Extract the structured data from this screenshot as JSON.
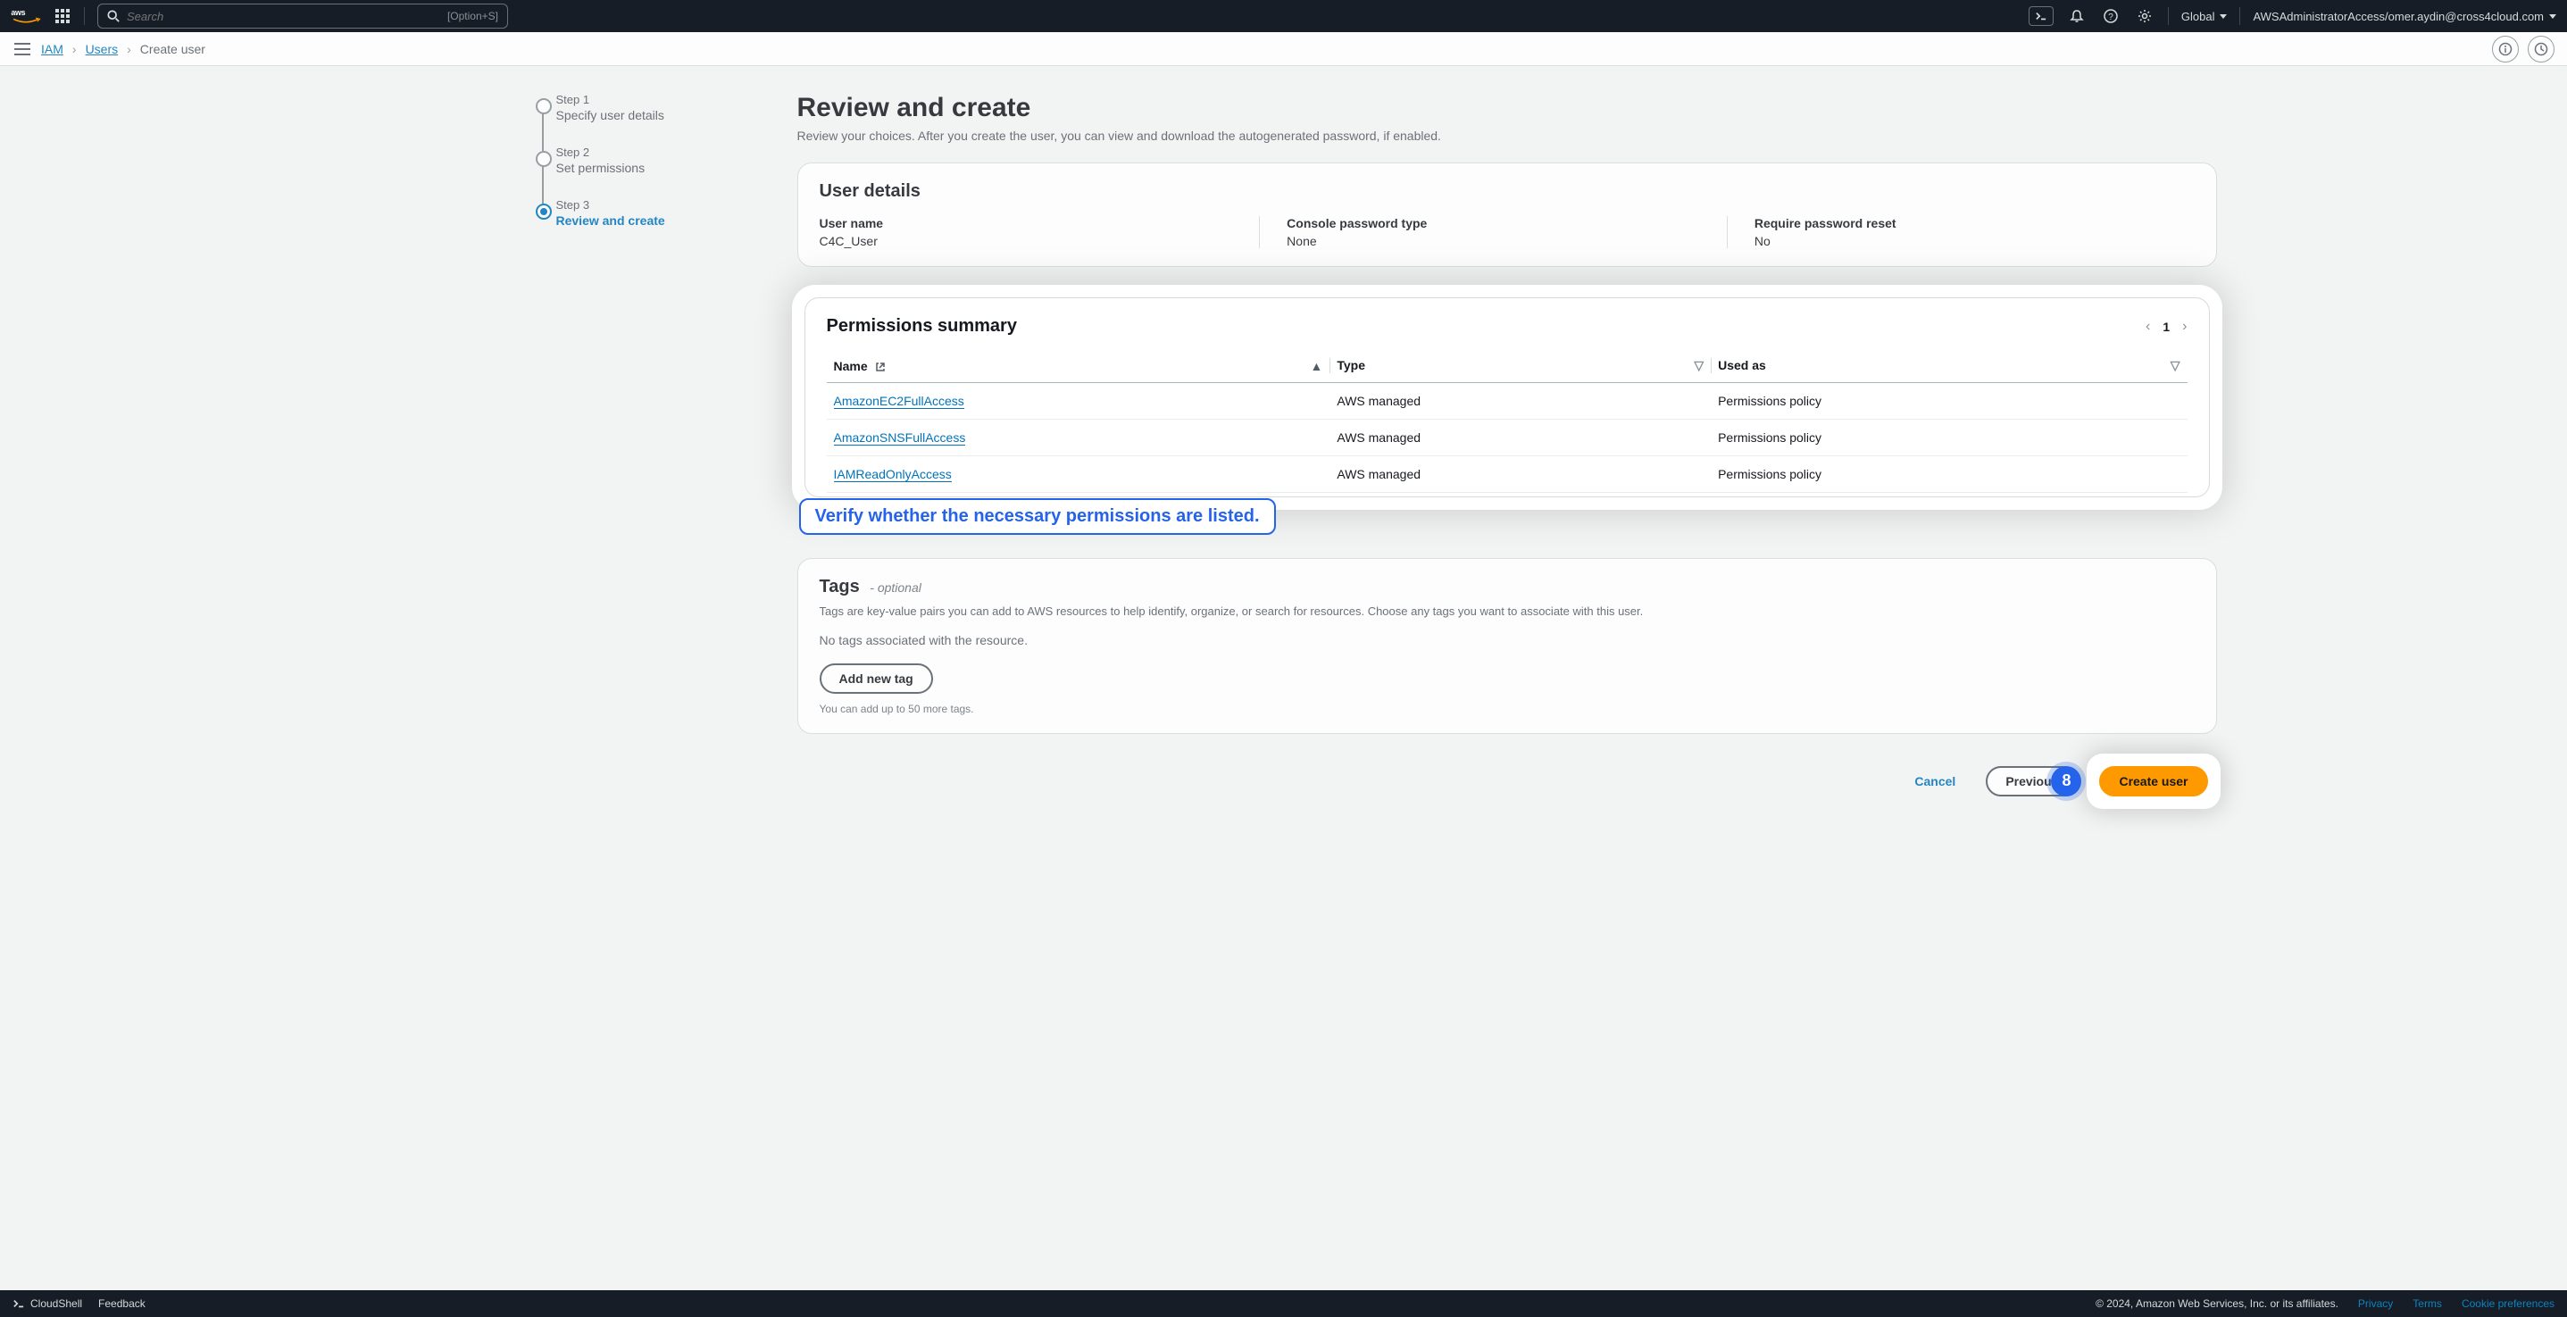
{
  "header": {
    "logo_text": "aws",
    "search_placeholder": "Search",
    "search_kbd": "[Option+S]",
    "region": "Global",
    "account": "AWSAdministratorAccess/omer.aydin@cross4cloud.com"
  },
  "breadcrumb": {
    "items": [
      "IAM",
      "Users",
      "Create user"
    ]
  },
  "steps": [
    {
      "label": "Step 1",
      "title": "Specify user details"
    },
    {
      "label": "Step 2",
      "title": "Set permissions"
    },
    {
      "label": "Step 3",
      "title": "Review and create"
    }
  ],
  "page": {
    "title": "Review and create",
    "subtitle": "Review your choices. After you create the user, you can view and download the autogenerated password, if enabled."
  },
  "user_details": {
    "heading": "User details",
    "fields": [
      {
        "k": "User name",
        "v": "C4C_User"
      },
      {
        "k": "Console password type",
        "v": "None"
      },
      {
        "k": "Require password reset",
        "v": "No"
      }
    ]
  },
  "permissions": {
    "heading": "Permissions summary",
    "columns": {
      "name": "Name",
      "type": "Type",
      "used_as": "Used as"
    },
    "rows": [
      {
        "name": "AmazonEC2FullAccess",
        "type": "AWS managed",
        "used_as": "Permissions policy"
      },
      {
        "name": "AmazonSNSFullAccess",
        "type": "AWS managed",
        "used_as": "Permissions policy"
      },
      {
        "name": "IAMReadOnlyAccess",
        "type": "AWS managed",
        "used_as": "Permissions policy"
      }
    ],
    "page": "1"
  },
  "annotation": {
    "text": "Verify whether the necessary permissions are listed.",
    "step_number": "8"
  },
  "tags": {
    "heading": "Tags",
    "optional": "- optional",
    "description": "Tags are key-value pairs you can add to AWS resources to help identify, organize, or search for resources. Choose any tags you want to associate with this user.",
    "empty": "No tags associated with the resource.",
    "add_btn": "Add new tag",
    "limit_note": "You can add up to 50 more tags."
  },
  "actions": {
    "cancel": "Cancel",
    "previous": "Previous",
    "create": "Create user"
  },
  "footer": {
    "cloudshell": "CloudShell",
    "feedback": "Feedback",
    "copyright": "© 2024, Amazon Web Services, Inc. or its affiliates.",
    "privacy": "Privacy",
    "terms": "Terms",
    "cookies": "Cookie preferences"
  }
}
